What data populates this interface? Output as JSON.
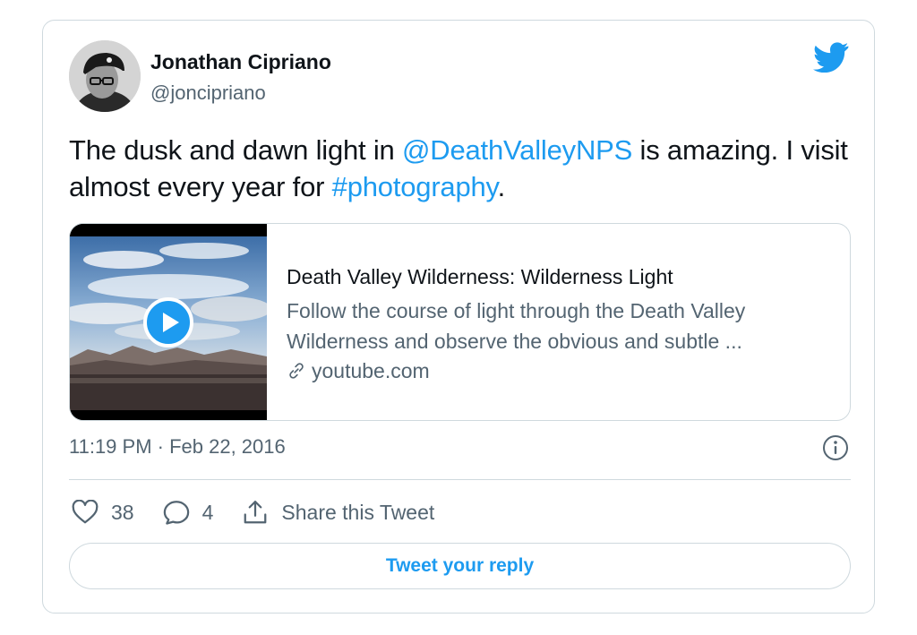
{
  "author": {
    "name": "Jonathan Cipriano",
    "handle": "@joncipriano"
  },
  "tweet": {
    "text_part1": "The dusk and dawn light in ",
    "mention": "@DeathValleyNPS",
    "text_part2": " is amazing. I visit almost every year for ",
    "hashtag": "#photography",
    "text_part3": "."
  },
  "embed": {
    "title": "Death Valley Wilderness: Wilderness Light",
    "description": "Follow the course of light through the Death Valley Wilderness and observe the obvious and subtle ...",
    "domain": "youtube.com",
    "thumbnail_icon": "play-button-icon"
  },
  "meta": {
    "timestamp": "11:19 PM · Feb 22, 2016"
  },
  "actions": {
    "likes": "38",
    "replies": "4",
    "share_label": "Share this Tweet"
  },
  "reply_button": {
    "label": "Tweet your reply"
  },
  "colors": {
    "accent": "#1d9bf0",
    "text": "#0f1419",
    "muted": "#536471",
    "border": "#cfd9de"
  }
}
